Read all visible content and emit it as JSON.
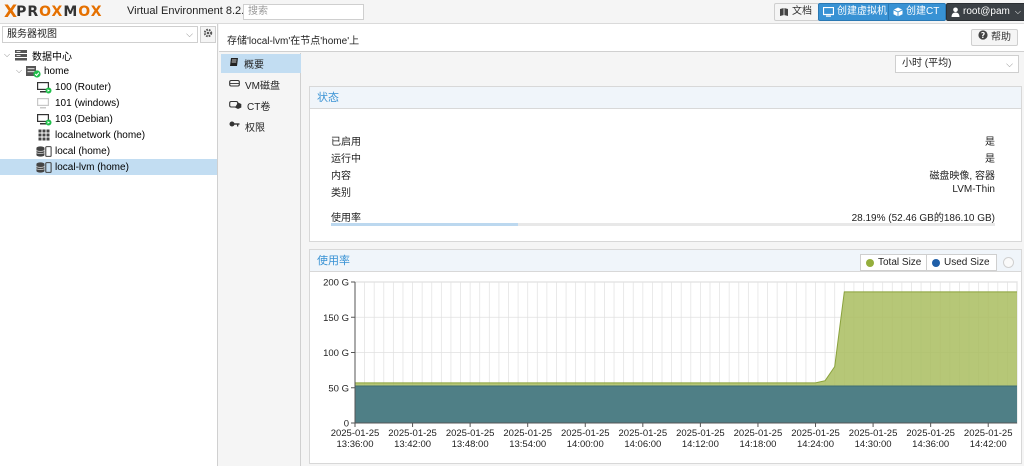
{
  "topbar": {
    "logo_x": "X",
    "logo_text_a": "PR",
    "logo_text_ox": "OX",
    "logo_text_b": "M",
    "logo_text_ox2": "OX",
    "product": "Virtual Environment 8.2.2",
    "search_placeholder": "搜索",
    "docs_label": "文档",
    "create_vm_label": "创建虚拟机",
    "create_ct_label": "创建CT",
    "user_label": "root@pam"
  },
  "tree": {
    "view_selector": "服务器视图",
    "items": [
      {
        "label": "数据中心",
        "icon": "datacenter-icon",
        "level": 0,
        "toggle": "⌵"
      },
      {
        "label": "home",
        "icon": "node-online-icon",
        "level": 1,
        "toggle": "⌵"
      },
      {
        "label": "100 (Router)",
        "icon": "vm-running-icon",
        "level": 2
      },
      {
        "label": "101 (windows)",
        "icon": "vm-stopped-icon",
        "level": 2
      },
      {
        "label": "103 (Debian)",
        "icon": "vm-running-icon",
        "level": 2
      },
      {
        "label": "localnetwork (home)",
        "icon": "network-grid-icon",
        "level": 2
      },
      {
        "label": "local (home)",
        "icon": "storage-icon",
        "level": 2
      },
      {
        "label": "local-lvm (home)",
        "icon": "storage-icon",
        "level": 2,
        "selected": true
      }
    ]
  },
  "header": {
    "breadcrumb": "存储'local-lvm'在节点'home'上",
    "help_label": "帮助"
  },
  "subnav": {
    "items": [
      {
        "label": "概要",
        "icon": "summary-book-icon",
        "active": true
      },
      {
        "label": "VM磁盘",
        "icon": "disk-icon"
      },
      {
        "label": "CT卷",
        "icon": "container-disk-icon"
      },
      {
        "label": "权限",
        "icon": "key-icon"
      }
    ]
  },
  "timeframe": {
    "value": "小时 (平均)"
  },
  "status": {
    "title": "状态",
    "rows": [
      {
        "label": "已启用",
        "value": "是"
      },
      {
        "label": "运行中",
        "value": "是"
      },
      {
        "label": "内容",
        "value": "磁盘映像, 容器"
      },
      {
        "label": "类别",
        "value": "LVM-Thin"
      }
    ],
    "usage_label": "使用率",
    "usage_value": "28.19% (52.46 GB的186.10 GB)",
    "usage_fraction": 0.2819
  },
  "usage_chart_panel": {
    "title": "使用率",
    "legend": [
      {
        "label": "Total Size",
        "color": "#94ae3c"
      },
      {
        "label": "Used Size",
        "color": "#1f5fa8"
      }
    ]
  },
  "chart_data": {
    "type": "area",
    "title": "",
    "xlabel": "",
    "ylabel": "",
    "ylim": [
      0,
      200
    ],
    "y_ticks": [
      "0",
      "50 G",
      "100 G",
      "150 G",
      "200 G"
    ],
    "y_tick_values": [
      0,
      50,
      100,
      150,
      200
    ],
    "x_tick_labels": [
      [
        "2025-01-25",
        "13:36:00"
      ],
      [
        "2025-01-25",
        "13:42:00"
      ],
      [
        "2025-01-25",
        "13:48:00"
      ],
      [
        "2025-01-25",
        "13:54:00"
      ],
      [
        "2025-01-25",
        "14:00:00"
      ],
      [
        "2025-01-25",
        "14:06:00"
      ],
      [
        "2025-01-25",
        "14:12:00"
      ],
      [
        "2025-01-25",
        "14:18:00"
      ],
      [
        "2025-01-25",
        "14:24:00"
      ],
      [
        "2025-01-25",
        "14:30:00"
      ],
      [
        "2025-01-25",
        "14:36:00"
      ],
      [
        "2025-01-25",
        "14:42:00"
      ]
    ],
    "grid": true,
    "series": [
      {
        "name": "Total Size",
        "color": "#a9bd5f",
        "x": [
          "13:36",
          "14:24",
          "14:25",
          "14:26",
          "14:27",
          "14:45"
        ],
        "values": [
          57,
          57,
          60,
          80,
          186,
          186
        ]
      },
      {
        "name": "Used Size",
        "color": "#4f7f86",
        "x": [
          "13:36",
          "14:45"
        ],
        "values": [
          52.46,
          52.46
        ]
      }
    ]
  }
}
